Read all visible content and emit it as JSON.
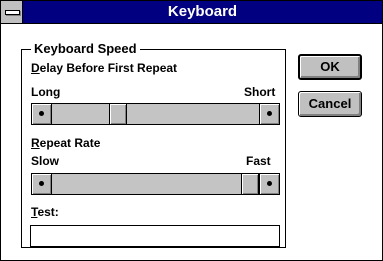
{
  "window": {
    "title": "Keyboard"
  },
  "group": {
    "label": "Keyboard Speed"
  },
  "delay": {
    "label_prefix": "D",
    "label_rest": "elay Before First Repeat",
    "min_label": "Long",
    "max_label": "Short",
    "value_fraction": 0.3
  },
  "repeat": {
    "label_prefix": "R",
    "label_rest": "epeat Rate",
    "min_label": "Slow",
    "max_label": "Fast",
    "value_fraction": 1.0
  },
  "test": {
    "label_prefix": "T",
    "label_rest": "est:",
    "value": ""
  },
  "buttons": {
    "ok": "OK",
    "cancel": "Cancel"
  }
}
